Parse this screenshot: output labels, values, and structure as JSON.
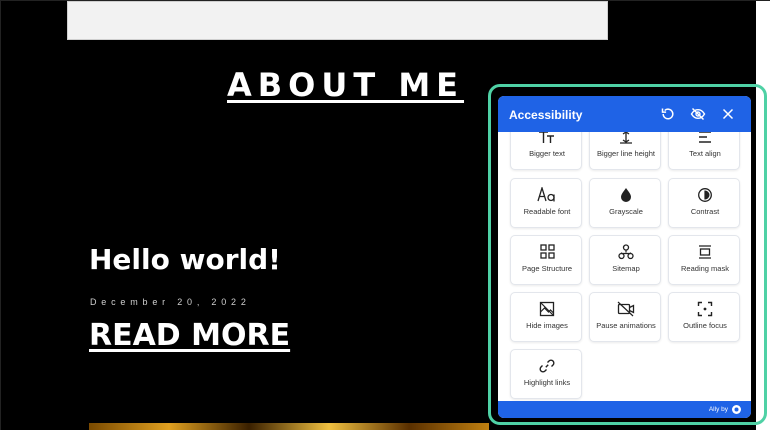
{
  "page": {
    "heading": "ABOUT ME",
    "post_title": "Hello world!",
    "post_date": "December 20, 2022",
    "read_more": "READ MORE"
  },
  "accessibility": {
    "title": "Accessibility",
    "header_icons": [
      "reset-icon",
      "hide-eye-icon",
      "close-icon"
    ],
    "tiles": [
      {
        "label": "Bigger text",
        "icon": "text-size-icon"
      },
      {
        "label": "Bigger line height",
        "icon": "line-height-icon"
      },
      {
        "label": "Text align",
        "icon": "text-align-icon"
      },
      {
        "label": "Readable font",
        "icon": "readable-font-icon"
      },
      {
        "label": "Grayscale",
        "icon": "grayscale-icon"
      },
      {
        "label": "Contrast",
        "icon": "contrast-icon"
      },
      {
        "label": "Page Structure",
        "icon": "page-structure-icon"
      },
      {
        "label": "Sitemap",
        "icon": "sitemap-icon"
      },
      {
        "label": "Reading mask",
        "icon": "reading-mask-icon"
      },
      {
        "label": "Hide images",
        "icon": "hide-images-icon"
      },
      {
        "label": "Pause animations",
        "icon": "pause-animations-icon"
      },
      {
        "label": "Outline focus",
        "icon": "outline-focus-icon"
      },
      {
        "label": "Highlight links",
        "icon": "link-icon"
      }
    ],
    "footer": {
      "label": "Ally by"
    }
  },
  "colors": {
    "header_blue": "#1f63e6",
    "outline_green": "#4fd1a5",
    "page_background": "#000000"
  }
}
